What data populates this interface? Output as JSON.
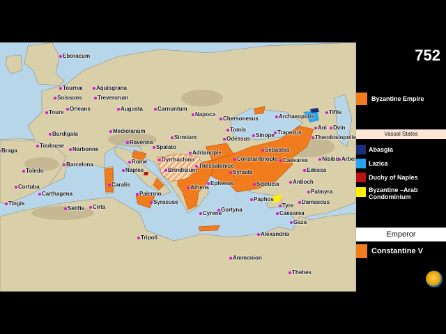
{
  "year": "752",
  "legend": {
    "empire_label": "Byzantine Empire",
    "empire_color": "#f07c1e",
    "vassal_title": "Vassal States",
    "vassals": [
      {
        "label": "Abasgia",
        "color": "#1b2e7a"
      },
      {
        "label": "Lazica",
        "color": "#2aa3f0"
      },
      {
        "label": "Duchy of Naples",
        "color": "#b81212"
      },
      {
        "label": "Byzantine –Arab Condominium",
        "color": "#ffee00"
      }
    ],
    "emperor_title": "Emperor",
    "emperor_name": "Constantine V",
    "emperor_color": "#f07c1e"
  },
  "cities": [
    {
      "name": "Eboracum"
    },
    {
      "name": "Tournai"
    },
    {
      "name": "Aquisgrana"
    },
    {
      "name": "Soissons"
    },
    {
      "name": "Treverorum"
    },
    {
      "name": "Tours"
    },
    {
      "name": "Orleans"
    },
    {
      "name": "Augusta"
    },
    {
      "name": "Carnuntum"
    },
    {
      "name": "Napoca"
    },
    {
      "name": "Chersonesus"
    },
    {
      "name": "Archaeopolis"
    },
    {
      "name": "Tiflis"
    },
    {
      "name": "Ani"
    },
    {
      "name": "Dvin"
    },
    {
      "name": "Theodosiopolis"
    },
    {
      "name": "Burdigala"
    },
    {
      "name": "Mediolanum"
    },
    {
      "name": "Sirmium"
    },
    {
      "name": "Tomis"
    },
    {
      "name": "Odessus"
    },
    {
      "name": "Sinope"
    },
    {
      "name": "Trapezus"
    },
    {
      "name": "Toulouse"
    },
    {
      "name": "Ravenna"
    },
    {
      "name": "Narbonne"
    },
    {
      "name": "Spalato"
    },
    {
      "name": "Adrianople"
    },
    {
      "name": "Sebastea"
    },
    {
      "name": "Nisibis"
    },
    {
      "name": "Arbela"
    },
    {
      "name": "Braga"
    },
    {
      "name": "Barcelona"
    },
    {
      "name": "Rome"
    },
    {
      "name": "Dyrrhachion"
    },
    {
      "name": "Thessalonice"
    },
    {
      "name": "Constantinople"
    },
    {
      "name": "Caesarea"
    },
    {
      "name": "Toledo"
    },
    {
      "name": "Naples"
    },
    {
      "name": "Brindisium"
    },
    {
      "name": "Synada"
    },
    {
      "name": "Edessa"
    },
    {
      "name": "Cortuba"
    },
    {
      "name": "Caralis"
    },
    {
      "name": "Ephesos"
    },
    {
      "name": "Seleucia"
    },
    {
      "name": "Antioch"
    },
    {
      "name": "Carthagena"
    },
    {
      "name": "Athens"
    },
    {
      "name": "Palmyra"
    },
    {
      "name": "Tingis"
    },
    {
      "name": "Palermo"
    },
    {
      "name": "Syracuse"
    },
    {
      "name": "Damascus"
    },
    {
      "name": "Paphos"
    },
    {
      "name": "Setifis"
    },
    {
      "name": "Cirta"
    },
    {
      "name": "Gortyna"
    },
    {
      "name": "Tyre"
    },
    {
      "name": "Caesarea"
    },
    {
      "name": "Gaza"
    },
    {
      "name": "Cyrene"
    },
    {
      "name": "Alexandria"
    },
    {
      "name": "Tripoli"
    },
    {
      "name": "Ammonion"
    },
    {
      "name": "Thebes"
    }
  ]
}
